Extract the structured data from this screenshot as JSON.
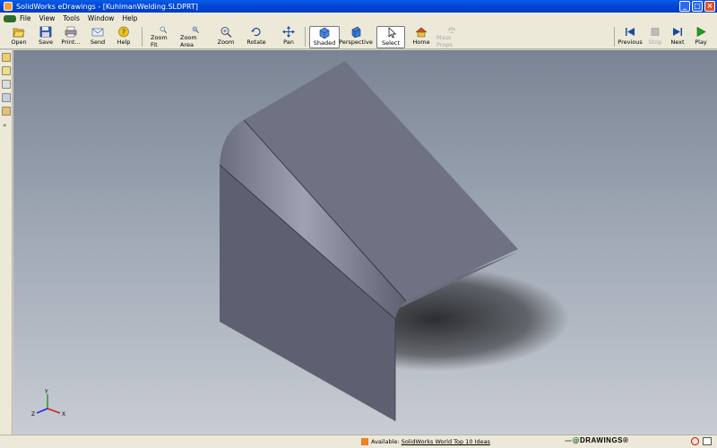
{
  "window": {
    "title": "SolidWorks eDrawings - [KuhlmanWelding.SLDPRT]"
  },
  "menu": [
    "File",
    "View",
    "Tools",
    "Window",
    "Help"
  ],
  "toolbar": {
    "open": "Open",
    "save": "Save",
    "print": "Print...",
    "send": "Send",
    "help": "Help",
    "zoom_fit": "Zoom Fit",
    "zoom_area": "Zoom Area",
    "zoom": "Zoom",
    "rotate": "Rotate",
    "pan": "Pan",
    "shaded": "Shaded",
    "perspective": "Perspective",
    "select": "Select",
    "home": "Home",
    "mass_props": "Mass Props",
    "previous": "Previous",
    "stop": "Stop",
    "next": "Next",
    "play": "Play"
  },
  "status": {
    "available_label": "Available:",
    "news_link": "SolidWorks World Top 10 Ideas",
    "brand": "DRAWINGS®"
  },
  "colors": {
    "title_bar": "#0046d5",
    "chrome": "#ece9d8",
    "model_top": "#6f7282",
    "model_front": "#5c5f6e"
  },
  "triad": {
    "x": "X",
    "y": "Y",
    "z": "Z"
  }
}
